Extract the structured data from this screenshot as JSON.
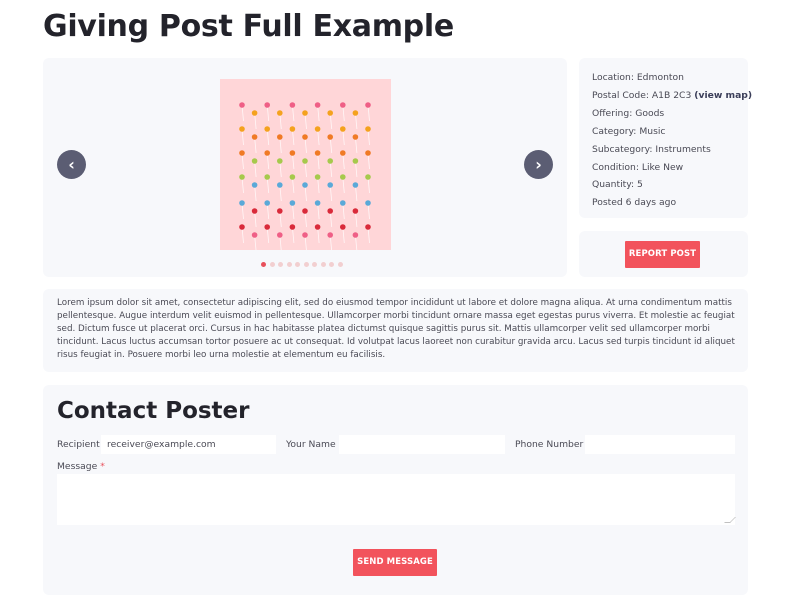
{
  "title": "Giving Post Full Example",
  "carousel": {
    "prev_icon": "‹",
    "next_icon": "›",
    "image_description_icon": "pins-image",
    "slide_count": 10,
    "active_slide": 1,
    "colors": {
      "image_bg": "#ffd6d8",
      "active_dot": "#e8505b",
      "inactive_dot": "#f2cfd0"
    }
  },
  "details": {
    "location": "Location: Edmonton",
    "postal_code": "Postal Code: A1B 2C3",
    "view_map": "(view map)",
    "offering": "Offering: Goods",
    "category": "Category: Music",
    "subcategory": "Subcategory: Instruments",
    "condition": "Condition: Like New",
    "quantity": "Quantity: 5",
    "posted": "Posted 6 days ago"
  },
  "report_button": "REPORT POST",
  "description": "Lorem ipsum dolor sit amet, consectetur adipiscing elit, sed do eiusmod tempor incididunt ut labore et dolore magna aliqua. At urna condimentum mattis pellentesque. Augue interdum velit euismod in pellentesque. Ullamcorper morbi tincidunt ornare massa eget egestas purus viverra. Et molestie ac feugiat sed. Dictum fusce ut placerat orci. Cursus in hac habitasse platea dictumst quisque sagittis purus sit. Mattis ullamcorper velit sed ullamcorper morbi tincidunt. Lacus luctus accumsan tortor posuere ac ut consequat. Id volutpat lacus laoreet non curabitur gravida arcu. Lacus sed turpis tincidunt id aliquet risus feugiat in. Posuere morbi leo urna molestie at elementum eu facilisis.",
  "contact": {
    "title": "Contact Poster",
    "recipient_label": "Recipient",
    "recipient_value": "receiver@example.com",
    "name_label": "Your Name",
    "name_value": "",
    "phone_label": "Phone Number",
    "phone_value": "",
    "message_label": "Message",
    "required_mark": "*",
    "send_button": "SEND MESSAGE"
  },
  "colors": {
    "accent": "#f2535c",
    "panel_bg": "#f7f8fb",
    "nav_button": "#5b5d73"
  }
}
